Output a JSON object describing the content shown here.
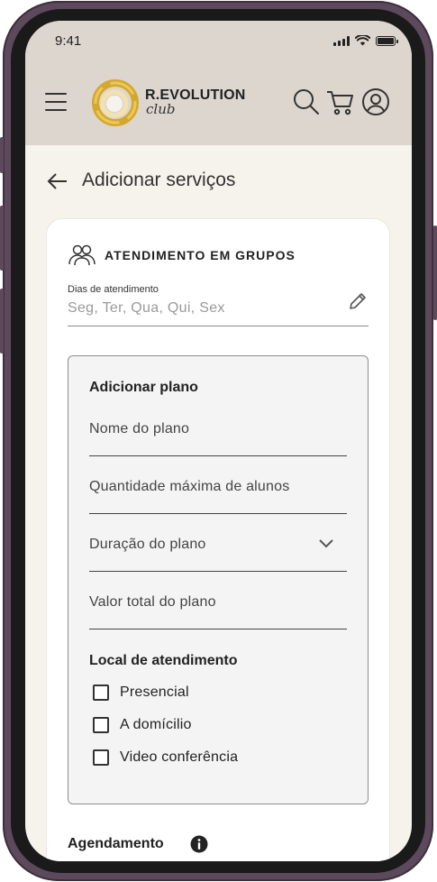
{
  "status_bar": {
    "time": "9:41"
  },
  "header": {
    "brand_name": "R.EVOLUTION",
    "brand_sub": "club",
    "icons": [
      "menu-icon",
      "search-icon",
      "cart-icon",
      "user-icon"
    ]
  },
  "page": {
    "title": "Adicionar serviços"
  },
  "section": {
    "title": "ATENDIMENTO EM GRUPOS",
    "icon": "group-icon",
    "days_label": "Dias de atendimento",
    "days_value": "Seg, Ter, Qua, Qui, Sex"
  },
  "plan": {
    "title": "Adicionar plano",
    "fields": [
      {
        "placeholder": "Nome do plano"
      },
      {
        "placeholder": "Quantidade máxima de alunos"
      },
      {
        "placeholder": "Duração do plano"
      },
      {
        "placeholder": "Valor total do plano"
      }
    ],
    "local_title": "Local de atendimento",
    "options": [
      {
        "label": "Presencial",
        "checked": false
      },
      {
        "label": "A domícilio",
        "checked": false
      },
      {
        "label": "Video conferência",
        "checked": false
      }
    ]
  },
  "scheduling": {
    "title": "Agendamento"
  },
  "colors": {
    "header_bg": "#ddd6ce",
    "screen_bg": "#f6f2ec",
    "frame": "#5c4a5c",
    "logo_gold": "#d4a82c"
  }
}
